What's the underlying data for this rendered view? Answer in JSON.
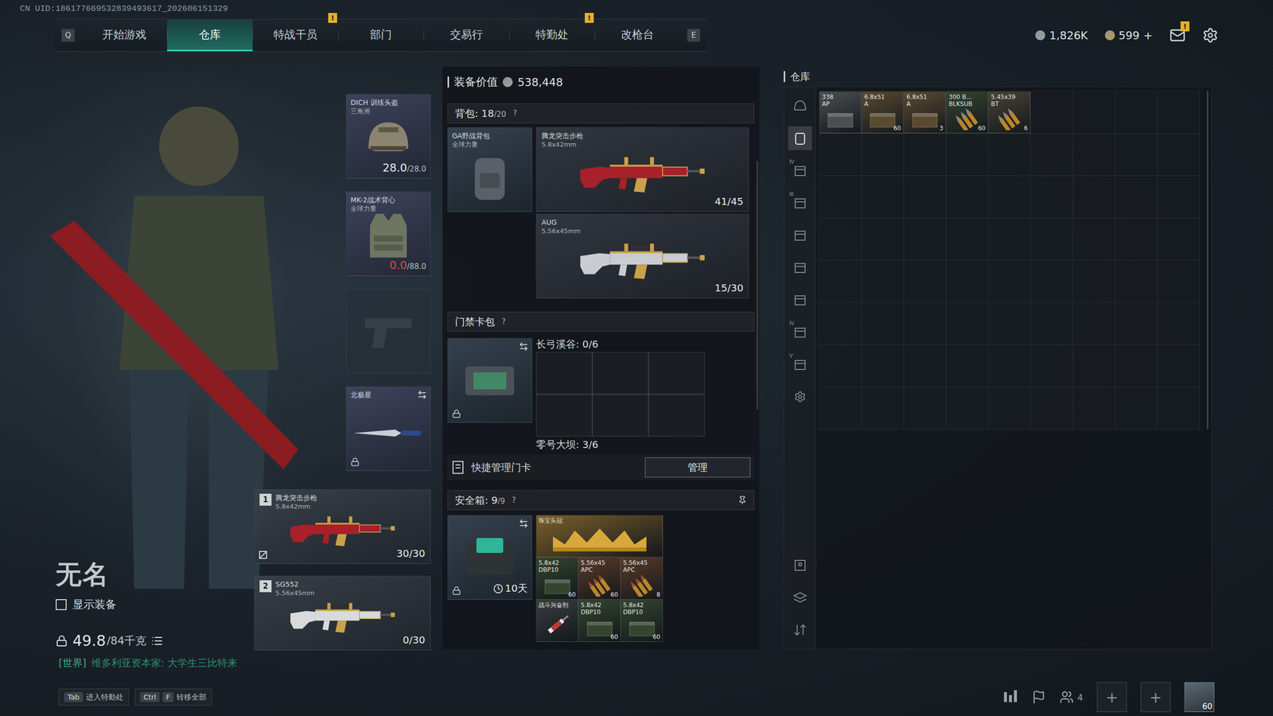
{
  "uid": "CN UID:186177669532839493617_202606151329",
  "nav": {
    "prev_key": "Q",
    "next_key": "E",
    "tabs": [
      {
        "label": "开始游戏",
        "selected": false,
        "badge": ""
      },
      {
        "label": "仓库",
        "selected": true,
        "badge": ""
      },
      {
        "label": "特战干员",
        "selected": false,
        "badge": "!"
      },
      {
        "label": "部门",
        "selected": false,
        "badge": ""
      },
      {
        "label": "交易行",
        "selected": false,
        "badge": ""
      },
      {
        "label": "特勤处",
        "selected": false,
        "badge": "!"
      },
      {
        "label": "改枪台",
        "selected": false,
        "badge": ""
      }
    ]
  },
  "wallet": {
    "currencies": [
      {
        "kind": "silver",
        "value": "1,826K",
        "action": ""
      },
      {
        "kind": "gold",
        "value": "599",
        "action": "+"
      }
    ],
    "mail_badge": "!"
  },
  "operator": {
    "name": "无名",
    "show_gear": {
      "label": "显示装备",
      "checked": false
    },
    "weight": "49.8",
    "weight_max": "/84千克"
  },
  "chat": {
    "channel": "[世界]",
    "message": "维多利亚资本家: 大学生三比特来"
  },
  "gear": [
    {
      "kind": "helmet",
      "name": "DICH 训练头盔",
      "sub": "三角洲",
      "reading": "28.0",
      "max": "/28.0",
      "warn": false,
      "locked": false,
      "swappable": false,
      "empty": false
    },
    {
      "kind": "vest",
      "name": "MK-2战术背心",
      "sub": "全球力量",
      "reading": "0.0",
      "max": "/88.0",
      "warn": true,
      "locked": false,
      "swappable": false,
      "empty": false
    },
    {
      "kind": "pistol",
      "name": "",
      "sub": "",
      "reading": "",
      "max": "",
      "warn": false,
      "locked": false,
      "swappable": false,
      "empty": true
    },
    {
      "kind": "melee",
      "name": "北极星",
      "sub": "",
      "reading": "",
      "max": "",
      "warn": false,
      "locked": true,
      "swappable": true,
      "empty": false
    }
  ],
  "weapons": [
    {
      "slot": "1",
      "name": "腾龙突击步枪",
      "ammo": "5.8x42mm",
      "count": "30/30",
      "color": "#a8202a",
      "flagged": true
    },
    {
      "slot": "2",
      "name": "SG552",
      "ammo": "5.56x45mm",
      "count": "0/30",
      "color": "#d8dadc",
      "flagged": false
    }
  ],
  "loadout": {
    "value_label": "装备价值",
    "value": "538,448",
    "backpack": {
      "label": "背包: ",
      "count": "18",
      "max": "/20",
      "help": "?",
      "item": {
        "name": "GA野战背包",
        "sub": "全球力量"
      },
      "weapons": [
        {
          "name": "腾龙突击步枪",
          "ammo": "5.8x42mm",
          "count": "41/45",
          "color": "#a8202a"
        },
        {
          "name": "AUG",
          "ammo": "5.56x45mm",
          "count": "15/30",
          "color": "#c9ccd0"
        }
      ]
    },
    "keycard": {
      "label": "门禁卡包",
      "help": "?",
      "locked": true,
      "swappable": true,
      "maps": [
        {
          "name": "长弓溪谷: 0/6"
        },
        {
          "name": "零号大坝: 3/6"
        }
      ],
      "quick": "快捷管理门卡",
      "manage": "管理"
    },
    "safe": {
      "label": "安全箱: ",
      "count": "9",
      "max": "/9",
      "help": "?",
      "pinned": true,
      "timer": "10天",
      "locked": true,
      "swappable": true,
      "items": [
        {
          "name": "珠宝头冠",
          "sub": "",
          "count": "",
          "kind": "crown",
          "color": "#7a5f2a"
        },
        {
          "name": "5.8x42",
          "sub": "DBP10",
          "count": "60",
          "kind": "ammo-box",
          "color": "#34452f"
        },
        {
          "name": "5.56x45",
          "sub": "APC",
          "count": "60",
          "kind": "rounds",
          "color": "#5a3a28"
        },
        {
          "name": "5.56x45",
          "sub": "APC",
          "count": "8",
          "kind": "rounds",
          "color": "#5a3a28"
        },
        {
          "name": "战斗兴奋剂",
          "sub": "",
          "count": "",
          "kind": "stim",
          "color": "#3a3d40"
        },
        {
          "name": "5.8x42",
          "sub": "DBP10",
          "count": "60",
          "kind": "ammo-box",
          "color": "#34452f"
        },
        {
          "name": "5.8x42",
          "sub": "DBP10",
          "count": "60",
          "kind": "ammo-box",
          "color": "#34452f"
        }
      ]
    }
  },
  "stash": {
    "title": "仓库",
    "side_top": [
      {
        "kind": "helmet",
        "tag": "",
        "selected": false
      },
      {
        "kind": "backpack",
        "tag": "",
        "selected": true
      },
      {
        "kind": "box",
        "tag": "IV",
        "selected": false
      },
      {
        "kind": "box",
        "tag": "III",
        "selected": false
      },
      {
        "kind": "box",
        "tag": "",
        "selected": false
      },
      {
        "kind": "box",
        "tag": "",
        "selected": false
      },
      {
        "kind": "box",
        "tag": "",
        "selected": false
      },
      {
        "kind": "box",
        "tag": "IV",
        "selected": false
      },
      {
        "kind": "box",
        "tag": "V",
        "selected": false
      },
      {
        "kind": "gear",
        "tag": "",
        "selected": false
      }
    ],
    "side_bottom": [
      {
        "kind": "id",
        "tag": "",
        "selected": false
      },
      {
        "kind": "layers",
        "tag": "",
        "selected": false
      },
      {
        "kind": "sort",
        "tag": "",
        "selected": false
      }
    ],
    "items": [
      {
        "name": "338",
        "sub": "AP",
        "count": "",
        "kind": "ammo-box",
        "color": "#4a4f52"
      },
      {
        "name": "6.8x51",
        "sub": "A",
        "count": "60",
        "kind": "ammo-box",
        "color": "#5a4a30"
      },
      {
        "name": "6.8x51",
        "sub": "A",
        "count": "3",
        "kind": "ammo-box",
        "color": "#5a4a30"
      },
      {
        "name": "300 B...",
        "sub": "BLKSUB",
        "count": "60",
        "kind": "rounds",
        "color": "#34452f"
      },
      {
        "name": "5.45x39",
        "sub": "BT",
        "count": "6",
        "kind": "rounds",
        "color": "#4a4236"
      }
    ]
  },
  "footer": {
    "shortcuts": [
      {
        "keys": [
          "Tab"
        ],
        "label": "进入特勤处"
      },
      {
        "keys": [
          "Ctrl",
          "F"
        ],
        "label": "转移全部"
      }
    ],
    "squad_count": "4",
    "slots": [
      "+",
      "+"
    ],
    "level": "60"
  }
}
